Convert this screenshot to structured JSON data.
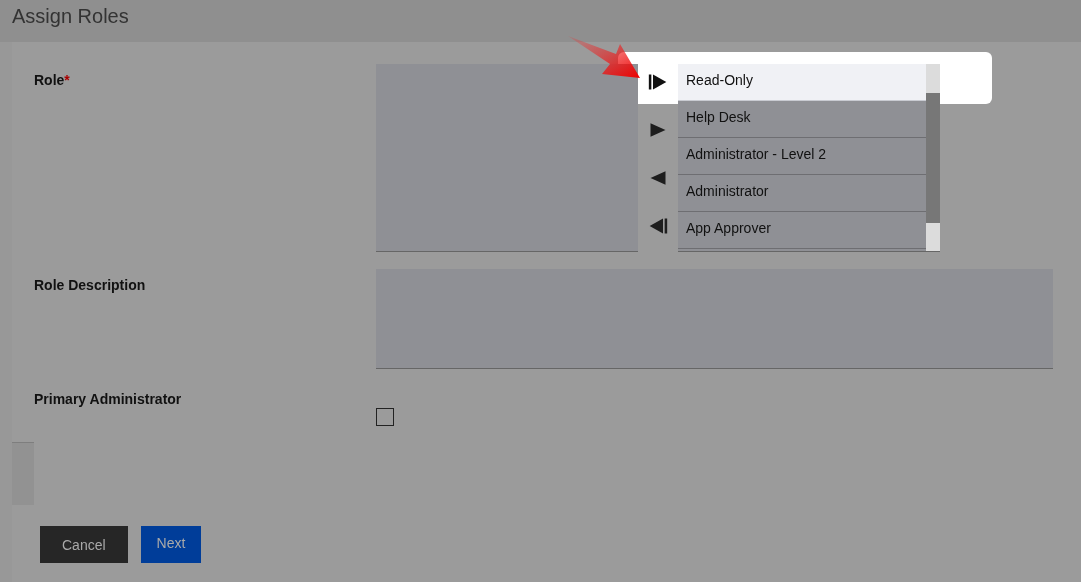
{
  "title": "Assign Roles",
  "role": {
    "label": "Role",
    "required_mark": "*",
    "assigned": [
      {
        "name": "Read-Only",
        "highlighted": true
      },
      {
        "name": "Help Desk",
        "highlighted": false
      },
      {
        "name": "Administrator - Level 2",
        "highlighted": false
      },
      {
        "name": "Administrator",
        "highlighted": false
      },
      {
        "name": "App Approver",
        "highlighted": false
      }
    ],
    "transfer_buttons": [
      {
        "kind": "add-all",
        "highlighted": true
      },
      {
        "kind": "add",
        "highlighted": false
      },
      {
        "kind": "remove",
        "highlighted": false
      },
      {
        "kind": "remove-all",
        "highlighted": false
      }
    ]
  },
  "role_description": {
    "label": "Role Description"
  },
  "primary_administrator": {
    "label": "Primary Administrator",
    "checked": false
  },
  "buttons": [
    {
      "kind": "cancel",
      "label": "Cancel"
    },
    {
      "kind": "next",
      "label": "Next"
    }
  ]
}
